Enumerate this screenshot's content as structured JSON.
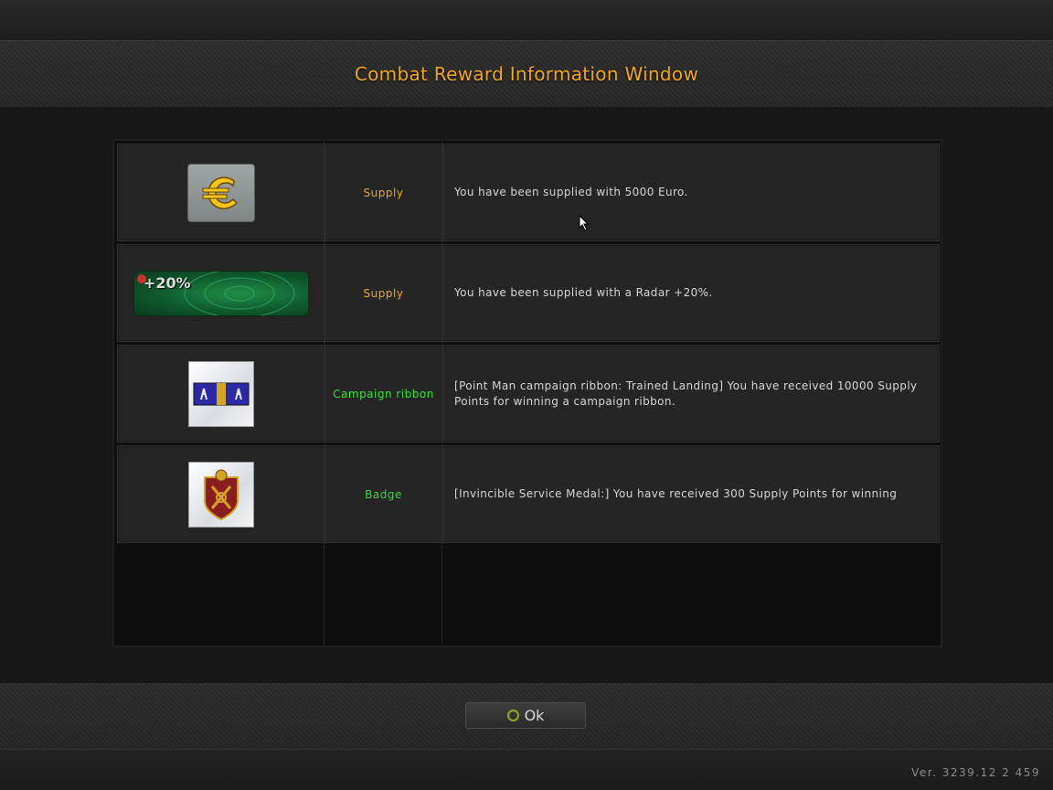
{
  "window": {
    "title": "Combat Reward Information Window"
  },
  "rewards": [
    {
      "icon": "euro-icon",
      "category": "Supply",
      "category_color": "#f2a817",
      "description": "You have been supplied with 5000 Euro."
    },
    {
      "icon": "radar-icon",
      "icon_text": "+20%",
      "category": "Supply",
      "category_color": "#f2a817",
      "description": "You have been supplied with a Radar +20%."
    },
    {
      "icon": "campaign-ribbon-icon",
      "category": "Campaign ribbon",
      "category_color": "#35e035",
      "description": "[Point Man campaign ribbon: Trained Landing] You have received 10000 Supply Points for winning a campaign ribbon."
    },
    {
      "icon": "badge-icon",
      "category": "Badge",
      "category_color": "#35e035",
      "description": "[Invincible Service Medal:] You have received 300 Supply Points for winning"
    }
  ],
  "footer": {
    "ok_label": "Ok",
    "version": "Ver. 3239.12 2 459"
  },
  "colors": {
    "accent_yellow": "#f2a817",
    "accent_green": "#35e035"
  }
}
